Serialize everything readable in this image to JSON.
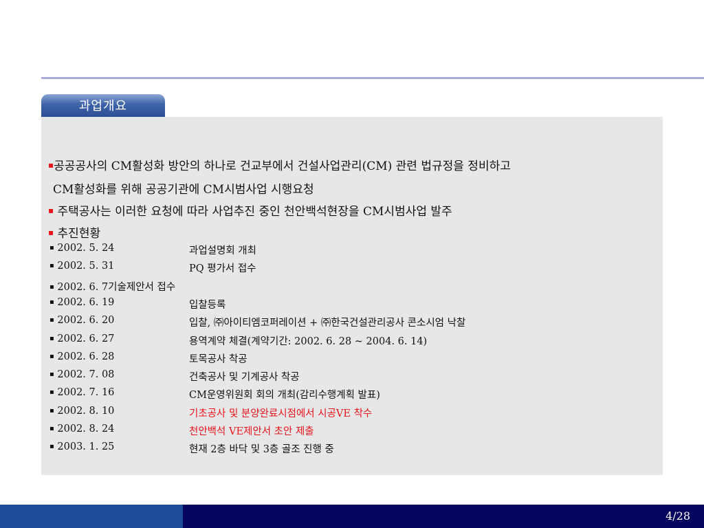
{
  "tab_title": "과업개요",
  "intro": [
    {
      "line1": "공공공사의 CM활성화 방안의 하나로 건교부에서 건설사업관리(CM) 관련 법규정을 정비하고",
      "line2": "CM활성화를 위해 공공기관에 CM시범사업 시행요청"
    },
    {
      "text": " 주택공사는 이러한 요청에 따라 사업추진 중인 천안백석현장을 CM시범사업 발주"
    },
    {
      "text": " 추진현황"
    }
  ],
  "schedule": [
    {
      "date": "2002. 5. 24",
      "desc": "과업설명회 개최"
    },
    {
      "date": "2002. 5. 31",
      "desc": "PQ 평가서 접수"
    },
    {
      "date": "2002. 6.  7기술제안서 접수",
      "desc": ""
    },
    {
      "date": "2002. 6. 19",
      "desc": "입찰등록"
    },
    {
      "date": "2002. 6. 20",
      "desc": "입찰, ㈜아이티엠코퍼레이션 +  ㈜한국건설관리공사 콘소시엄 낙찰"
    },
    {
      "date": "2002. 6. 27",
      "desc": "용역계약 체결(계약기간: 2002. 6. 28 ~ 2004. 6. 14)"
    },
    {
      "date": "2002. 6. 28",
      "desc": "토목공사 착공"
    },
    {
      "date": "2002. 7. 08",
      "desc": "건축공사 및 기계공사 착공"
    },
    {
      "date": "2002. 7. 16",
      "desc": "CM운영위원회 회의 개최(감리수행계획 발표)"
    },
    {
      "date": "2002. 8. 10",
      "desc": "기초공사 및 분양완료시점에서 시공VE 착수",
      "highlight": true
    },
    {
      "date": "2002. 8. 24",
      "desc": "천안백석 VE제안서 초안 제출",
      "highlight": true
    },
    {
      "date": "2003. 1. 25",
      "desc": "현재 2층 바닥 및 3층 골조 진행 중"
    }
  ],
  "bullet_symbol": "▪",
  "page_number": "4/28",
  "colors": {
    "accent_red": "#e8141b",
    "footer_navy": "#05045e",
    "footer_blue": "#1d4b9c",
    "panel_gray": "#e7e7e7"
  }
}
